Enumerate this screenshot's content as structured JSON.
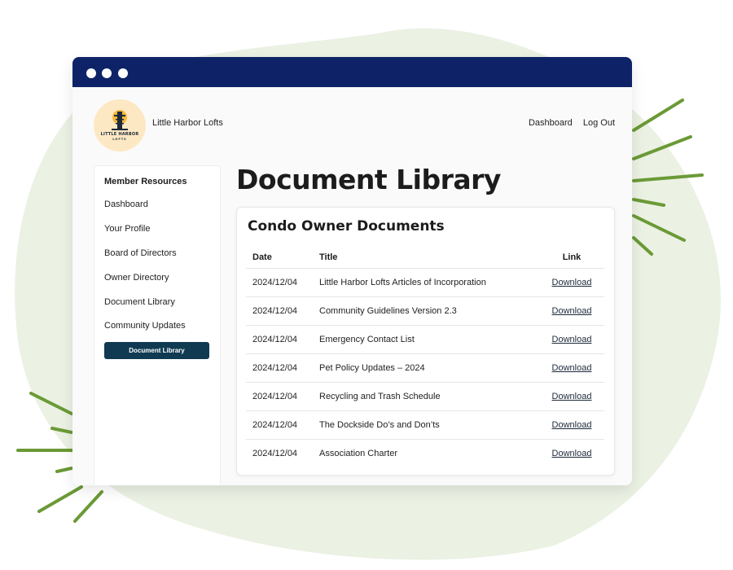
{
  "site": {
    "name": "Little Harbor Lofts",
    "logo_line1": "LITTLE HARBOR",
    "logo_line2": "LOFTS"
  },
  "top_nav": [
    "Dashboard",
    "Log Out"
  ],
  "sidebar": {
    "title": "Member Resources",
    "items": [
      "Dashboard",
      "Your Profile",
      "Board of Directors",
      "Owner Directory",
      "Document Library",
      "Community Updates"
    ],
    "active_button": "Document Library"
  },
  "page": {
    "title": "Document Library"
  },
  "card": {
    "title": "Condo Owner Documents",
    "columns": [
      "Date",
      "Title",
      "Link"
    ],
    "rows": [
      {
        "date": "2024/12/04",
        "title": "Little Harbor Lofts Articles of Incorporation",
        "link": "Download"
      },
      {
        "date": "2024/12/04",
        "title": "Community Guidelines Version 2.3",
        "link": "Download"
      },
      {
        "date": "2024/12/04",
        "title": "Emergency Contact List",
        "link": "Download"
      },
      {
        "date": "2024/12/04",
        "title": "Pet Policy Updates – 2024",
        "link": "Download"
      },
      {
        "date": "2024/12/04",
        "title": "Recycling and Trash Schedule",
        "link": "Download"
      },
      {
        "date": "2024/12/04",
        "title": "The Dockside Do’s and Don’ts",
        "link": "Download"
      },
      {
        "date": "2024/12/04",
        "title": "Association Charter",
        "link": "Download"
      }
    ]
  },
  "colors": {
    "titlebar": "#0e2367",
    "accent_button": "#0f3a52",
    "blob": "#ebf1e3",
    "rays": "#6a9a36"
  }
}
